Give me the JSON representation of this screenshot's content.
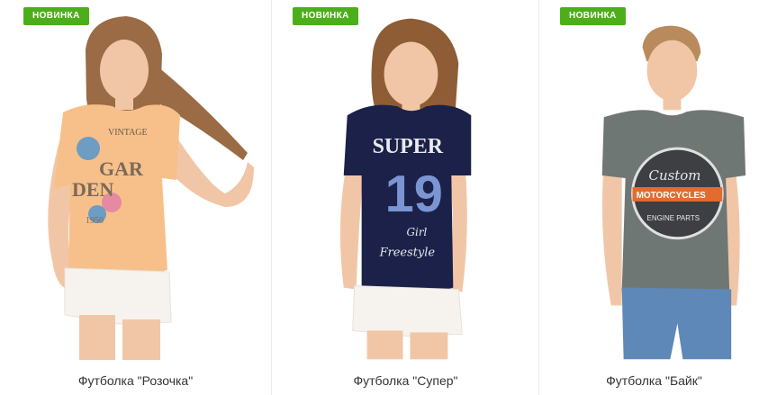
{
  "products": [
    {
      "badge": "НОВИНКА",
      "title": "Футболка \"Розочка\"",
      "print": [
        "VINTAGE",
        "GAR",
        "DEN",
        "1950"
      ]
    },
    {
      "badge": "НОВИНКА",
      "title": "Футболка \"Супер\"",
      "print": [
        "SUPER",
        "19",
        "Girl",
        "Freestyle"
      ]
    },
    {
      "badge": "НОВИНКА",
      "title": "Футболка \"Байк\"",
      "print": [
        "Custom",
        "MOTORCYCLES",
        "ENGINE PARTS"
      ]
    }
  ],
  "colors": {
    "badge": "#4caf1a",
    "peach_shirt": "#f7c08a",
    "navy_shirt": "#1b2148",
    "grey_shirt": "#6f7775",
    "shorts": "#f6f3ee",
    "jeans": "#5d88b8",
    "skin": "#f1c6a7",
    "hair": "#9a6b44"
  }
}
